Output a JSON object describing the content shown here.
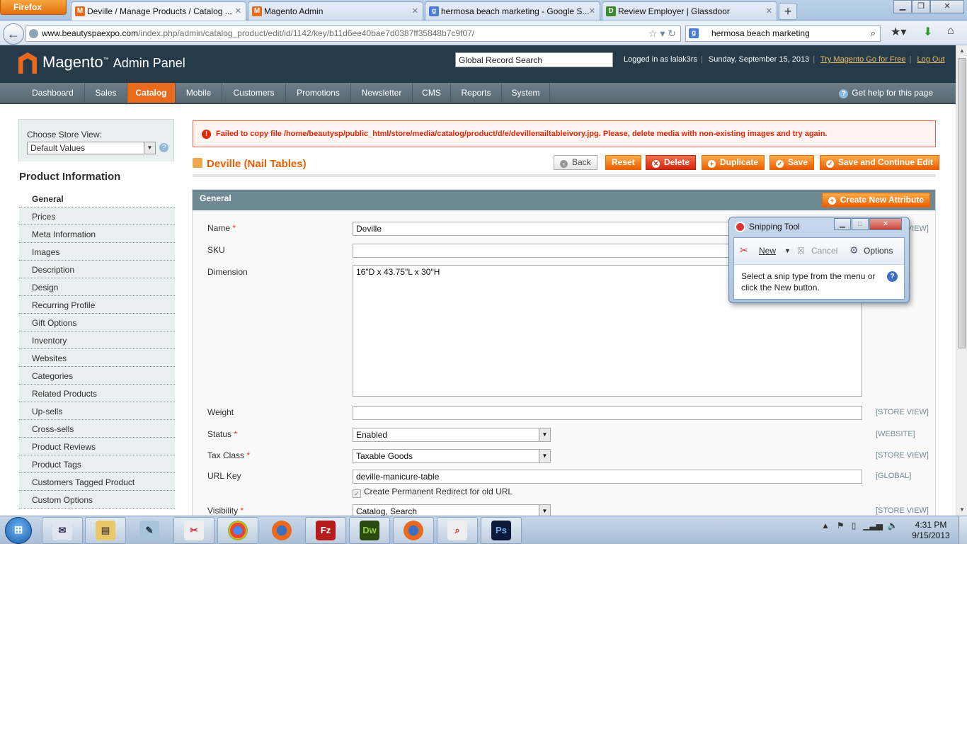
{
  "browser": {
    "menu_label": "Firefox",
    "tabs": [
      {
        "title": "Deville / Manage Products / Catalog ...",
        "icon": "magento-favicon"
      },
      {
        "title": "Magento Admin",
        "icon": "magento-favicon"
      },
      {
        "title": "hermosa beach marketing - Google S...",
        "icon": "google-favicon"
      },
      {
        "title": "Review Employer | Glassdoor",
        "icon": "glassdoor-favicon"
      }
    ],
    "url_domain": "www.beautyspaexpo.com",
    "url_path": "/index.php/admin/catalog_product/edit/id/1142/key/b11d6ee40bae7d0387ff35848b7c9f07/",
    "search_value": "hermosa beach marketing"
  },
  "magento": {
    "logo_text": "Magento",
    "logo_sub": "Admin Panel",
    "global_search": "Global Record Search",
    "logged_in": "Logged in as lalak3rs",
    "date": "Sunday, September 15, 2013",
    "try_link": "Try Magento Go for Free",
    "logout": "Log Out",
    "nav": [
      "Dashboard",
      "Sales",
      "Catalog",
      "Mobile",
      "Customers",
      "Promotions",
      "Newsletter",
      "CMS",
      "Reports",
      "System"
    ],
    "help": "Get help for this page"
  },
  "sidebar": {
    "store_label": "Choose Store View:",
    "store_value": "Default Values",
    "section_title": "Product Information",
    "tabs": [
      "General",
      "Prices",
      "Meta Information",
      "Images",
      "Description",
      "Design",
      "Recurring Profile",
      "Gift Options",
      "Inventory",
      "Websites",
      "Categories",
      "Related Products",
      "Up-sells",
      "Cross-sells",
      "Product Reviews",
      "Product Tags",
      "Customers Tagged Product",
      "Custom Options"
    ]
  },
  "main": {
    "error": "Failed to copy file /home/beautysp/public_html/store/media/catalog/product/d/e/devillenailtableivory.jpg. Please, delete media with non-existing images and try again.",
    "title": "Deville (Nail Tables)",
    "buttons": {
      "back": "Back",
      "reset": "Reset",
      "delete": "Delete",
      "duplicate": "Duplicate",
      "save": "Save",
      "save_continue": "Save and Continue Edit"
    },
    "fieldset_title": "General",
    "create_attr": "Create New Attribute",
    "fields": {
      "name": {
        "label": "Name",
        "value": "Deville",
        "scope": "[STORE VIEW]"
      },
      "sku": {
        "label": "SKU",
        "value": ""
      },
      "dimension": {
        "label": "Dimension",
        "value": "16\"D x 43.75\"L x 30\"H"
      },
      "weight": {
        "label": "Weight",
        "value": "",
        "scope": "[STORE VIEW]"
      },
      "status": {
        "label": "Status",
        "value": "Enabled",
        "scope": "[WEBSITE]"
      },
      "tax_class": {
        "label": "Tax Class",
        "value": "Taxable Goods",
        "scope": "[STORE VIEW]"
      },
      "url_key": {
        "label": "URL Key",
        "value": "deville-manicure-table",
        "scope": "[GLOBAL]"
      },
      "redirect": "Create Permanent Redirect for old URL",
      "visibility": {
        "label": "Visibility",
        "value": "Catalog, Search",
        "scope": "[STORE VIEW]"
      }
    }
  },
  "snipping": {
    "title": "Snipping Tool",
    "new": "New",
    "cancel": "Cancel",
    "options": "Options",
    "message": "Select a snip type from the menu or click the New button."
  },
  "taskbar": {
    "apps": [
      "outlook-icon",
      "explorer-icon",
      "notepad-icon",
      "snipping-icon",
      "chrome-icon",
      "firefox-icon",
      "filezilla-icon",
      "dreamweaver-icon",
      "firefox-icon",
      "magnifier-icon",
      "photoshop-icon"
    ],
    "time": "4:31 PM",
    "date": "9/15/2013"
  },
  "colors": {
    "accent": "#eb5e00",
    "header": "#253b49",
    "error": "#df280a"
  }
}
